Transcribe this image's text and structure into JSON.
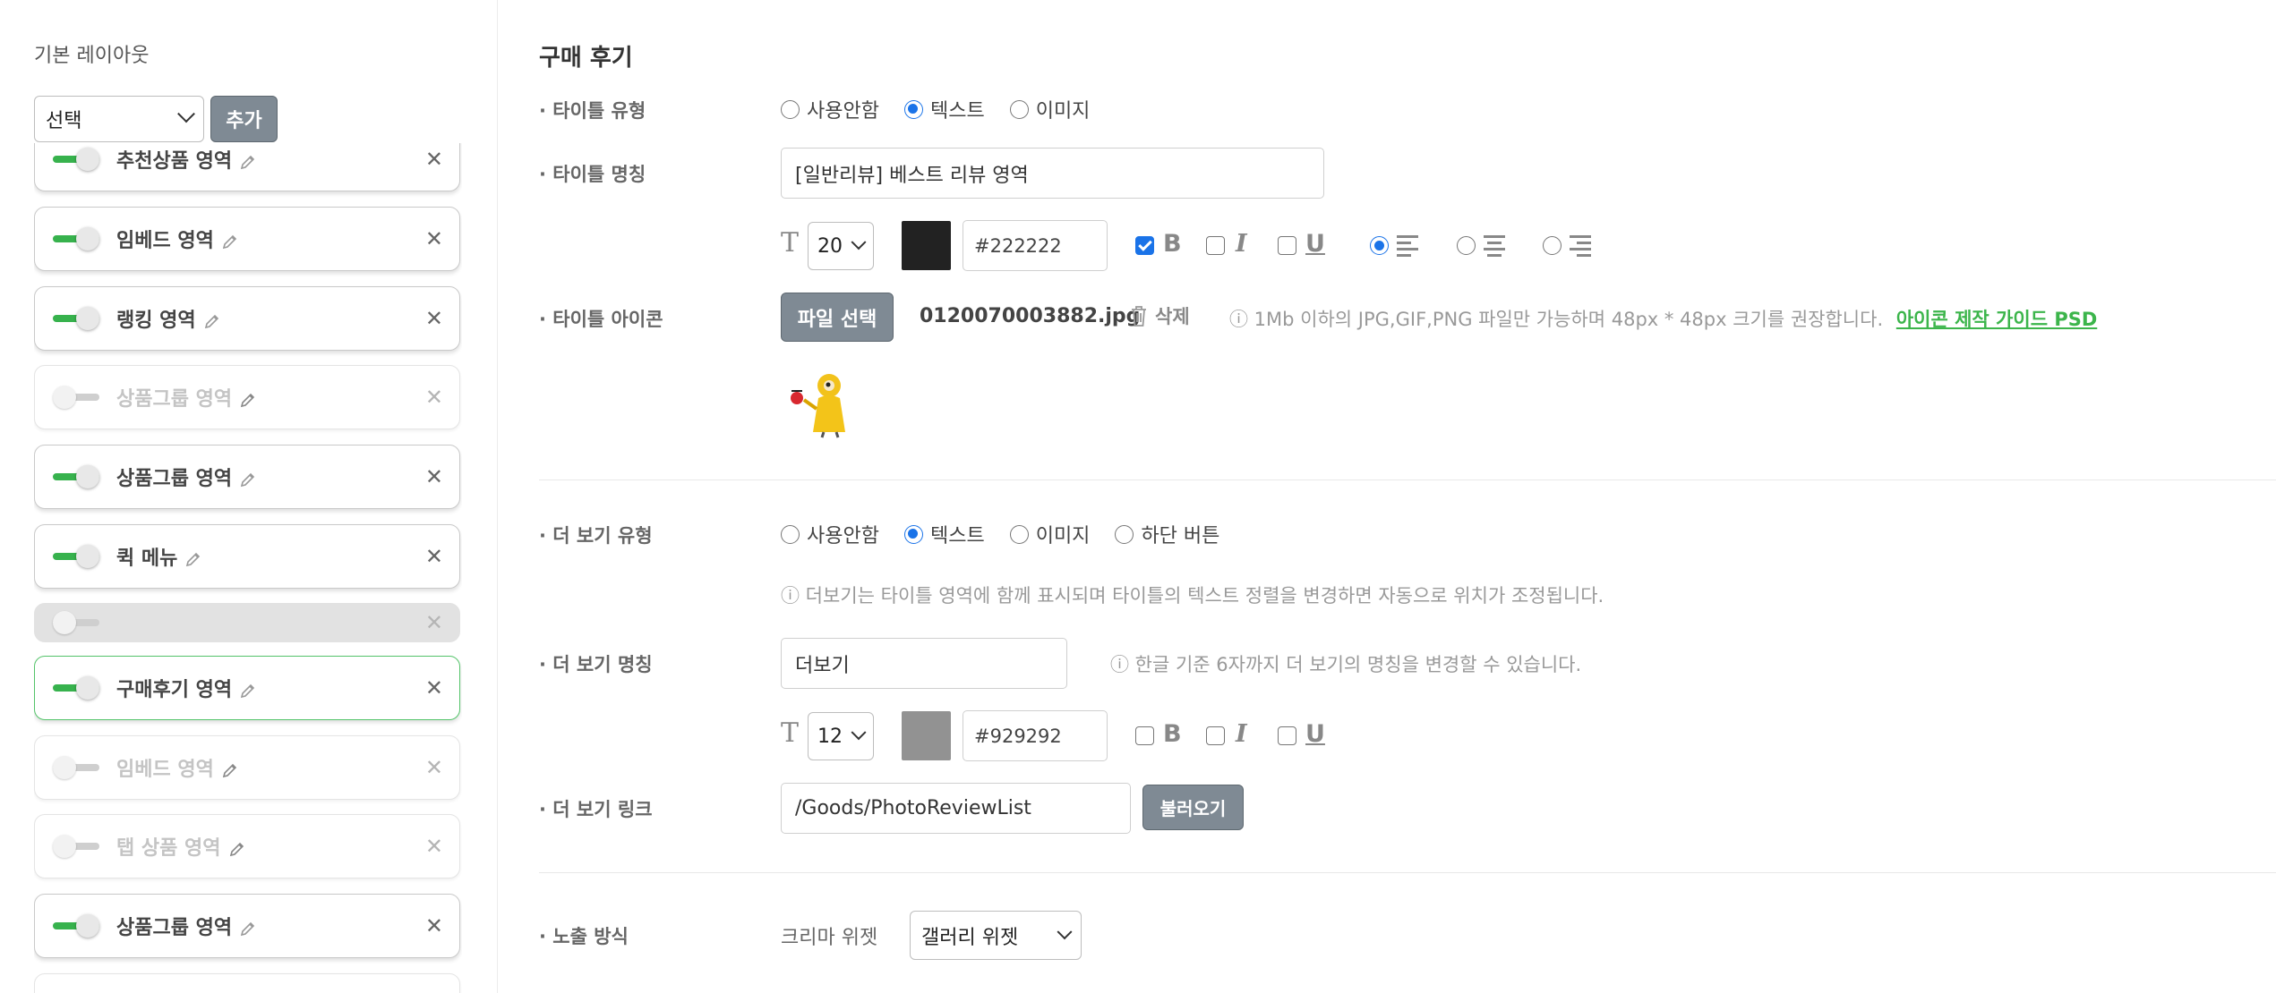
{
  "sidebar": {
    "title": "기본 레이아웃",
    "select_value": "선택",
    "add_label": "추가",
    "modules": [
      {
        "label": "추천상품 영역",
        "enabled": true,
        "state": "normal"
      },
      {
        "label": "임베드 영역",
        "enabled": true,
        "state": "normal"
      },
      {
        "label": "랭킹 영역",
        "enabled": true,
        "state": "normal"
      },
      {
        "label": "상품그룹 영역",
        "enabled": false,
        "state": "dim"
      },
      {
        "label": "상품그룹 영역",
        "enabled": true,
        "state": "normal"
      },
      {
        "label": "퀵 메뉴",
        "enabled": true,
        "state": "normal"
      },
      {
        "label": "",
        "enabled": false,
        "state": "empty"
      },
      {
        "label": "구매후기 영역",
        "enabled": true,
        "state": "active"
      },
      {
        "label": "임베드 영역",
        "enabled": false,
        "state": "dim"
      },
      {
        "label": "탭 상품 영역",
        "enabled": false,
        "state": "dim"
      },
      {
        "label": "상품그룹 영역",
        "enabled": true,
        "state": "normal"
      }
    ]
  },
  "main": {
    "section_title": "구매 후기",
    "title_type": {
      "label": "· 타이틀 유형",
      "options": [
        "사용안함",
        "텍스트",
        "이미지"
      ],
      "selected": "텍스트"
    },
    "title_name": {
      "label": "· 타이틀 명칭",
      "value": "[일반리뷰] 베스트 리뷰 영역",
      "font_size": "20",
      "color_hex": "#222222",
      "bold": true,
      "italic": false,
      "underline": false,
      "align": "left"
    },
    "title_icon": {
      "label": "· 타이틀 아이콘",
      "file_button": "파일 선택",
      "file_name": "0120070003882.jpg",
      "delete_label": "삭제",
      "info": "ⓘ 1Mb 이하의 JPG,GIF,PNG 파일만 가능하며 48px * 48px 크기를 권장합니다.",
      "guide_link": "아이콘 제작 가이드 PSD"
    },
    "more_type": {
      "label": "· 더 보기 유형",
      "options": [
        "사용안함",
        "텍스트",
        "이미지",
        "하단 버튼"
      ],
      "selected": "텍스트",
      "info": "ⓘ 더보기는 타이틀 영역에 함께 표시되며 타이틀의 텍스트 정렬을 변경하면 자동으로 위치가 조정됩니다."
    },
    "more_name": {
      "label": "· 더 보기 명칭",
      "value": "더보기",
      "info": "ⓘ 한글 기준 6자까지 더 보기의 명칭을 변경할 수 있습니다.",
      "font_size": "12",
      "color_hex": "#929292",
      "bold": false,
      "italic": false,
      "underline": false
    },
    "more_link": {
      "label": "· 더 보기 링크",
      "value": "/Goods/PhotoReviewList",
      "load_button": "불러오기"
    },
    "display": {
      "label": "· 노출 방식",
      "sub_label": "크리마 위젯",
      "select_value": "갤러리 위젯"
    }
  },
  "colors": {
    "accent_green": "#37b24d",
    "radio_blue": "#1a73e8",
    "title_swatch": "#222222",
    "more_swatch": "#929292",
    "button_gray": "#7f8a94"
  }
}
